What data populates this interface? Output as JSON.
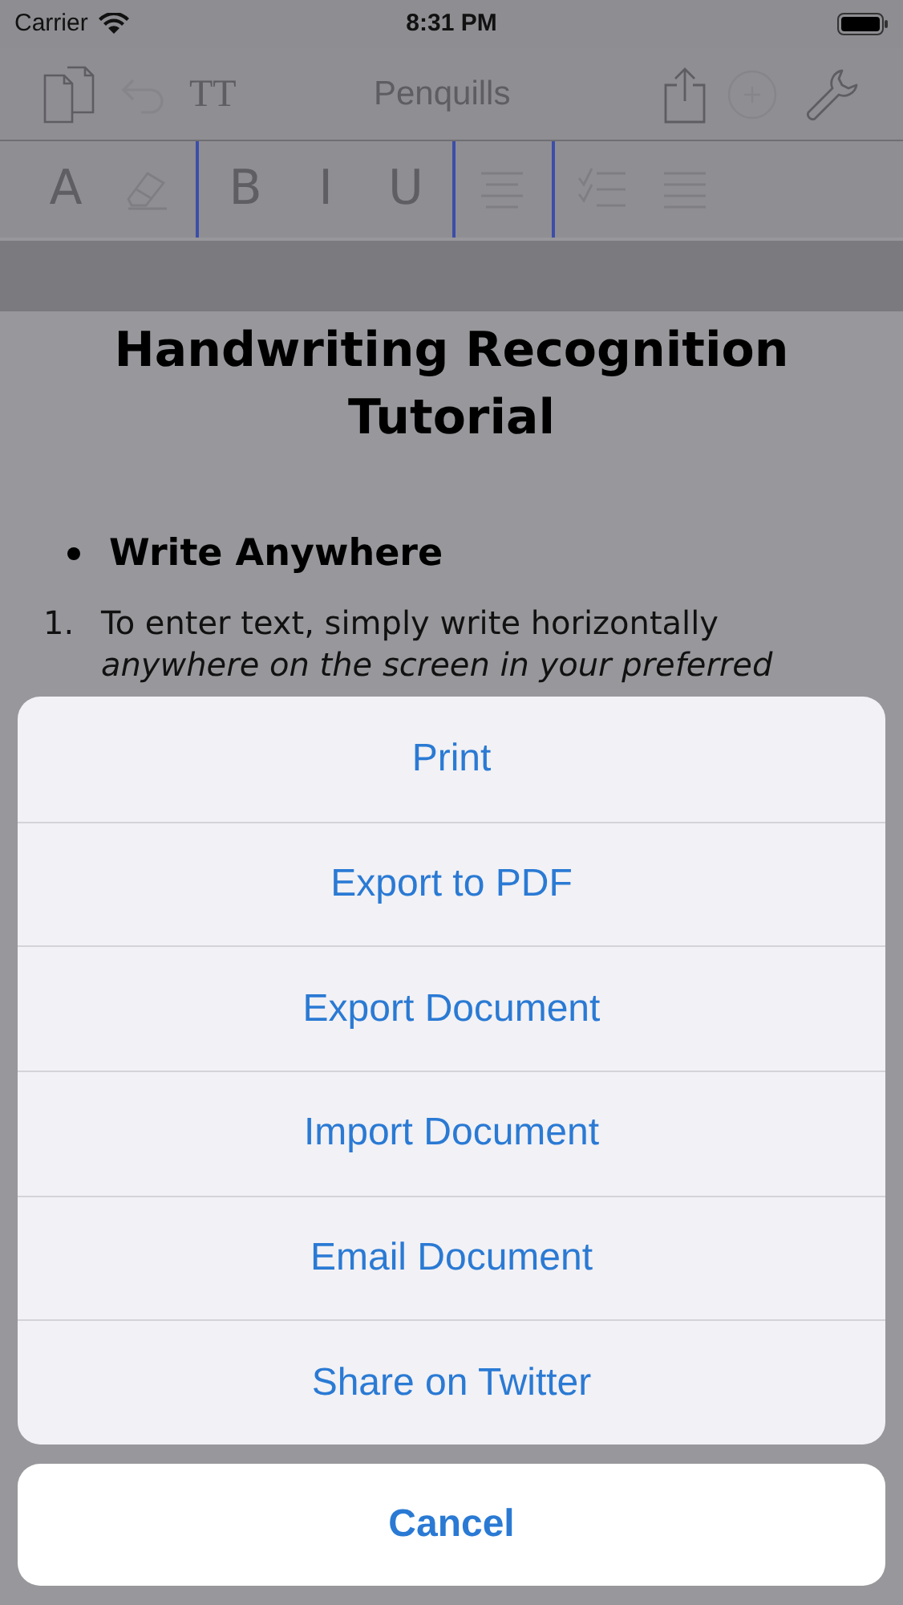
{
  "status_bar": {
    "carrier": "Carrier",
    "time": "8:31 PM"
  },
  "toolbar": {
    "font_button": "TT",
    "title": "Penquills"
  },
  "format_bar": {
    "groups": [
      [
        {
          "kind": "letter",
          "label": "A"
        },
        {
          "kind": "eraser"
        }
      ],
      [
        {
          "kind": "letter",
          "label": "B"
        },
        {
          "kind": "letter",
          "label": "I"
        },
        {
          "kind": "letter",
          "label": "U"
        }
      ],
      [
        {
          "kind": "align"
        }
      ],
      [
        {
          "kind": "checklist"
        },
        {
          "kind": "list"
        }
      ]
    ]
  },
  "document": {
    "title": "Handwriting Recognition Tutorial",
    "bullet": "Write Anywhere",
    "numbered_items": [
      {
        "number": "1.",
        "text": "To enter text, simply write horizontally *anywhere on the screen in your preferred*"
      }
    ]
  },
  "action_sheet": {
    "actions": [
      "Print",
      "Export to PDF",
      "Export Document",
      "Import Document",
      "Email Document",
      "Share on Twitter"
    ],
    "cancel": "Cancel"
  }
}
